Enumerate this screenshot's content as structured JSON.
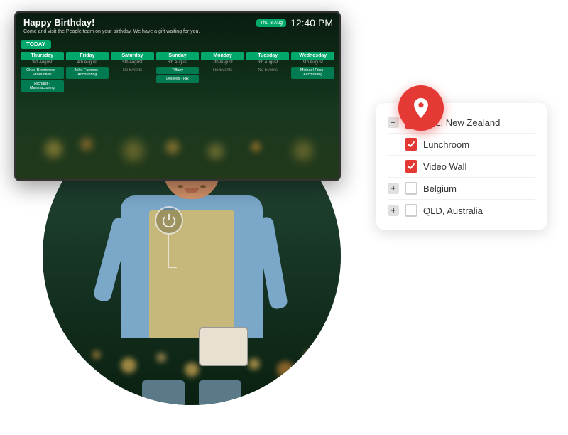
{
  "tv": {
    "birthday_title": "Happy Birthday!",
    "birthday_subtitle": "Come and visit the People team on your birthday. We have a gift waiting for you.",
    "date_badge": "Thu 3 Aug",
    "time": "12:40 PM",
    "today_label": "TODAY",
    "days": [
      {
        "name": "Thursday",
        "date": "3rd August",
        "events": [
          "Chad Brentwood - Production",
          "Richard - Manufacturing"
        ],
        "no_events": false
      },
      {
        "name": "Friday",
        "date": "4th August",
        "events": [
          "John Furness - Accounting"
        ],
        "no_events": false
      },
      {
        "name": "Saturday",
        "date": "5th August",
        "events": [],
        "no_events": true,
        "no_events_text": "No Events"
      },
      {
        "name": "Sunday",
        "date": "6th August",
        "events": [
          "Tiffany",
          "Delores - HR"
        ],
        "no_events": false
      },
      {
        "name": "Monday",
        "date": "7th August",
        "events": [],
        "no_events": true,
        "no_events_text": "No Events"
      },
      {
        "name": "Tuesday",
        "date": "8th August",
        "events": [],
        "no_events": true,
        "no_events_text": "No Events"
      },
      {
        "name": "Wednesday",
        "date": "9th August",
        "events": [
          "Michael Friss - Accounting"
        ],
        "no_events": false
      }
    ]
  },
  "location_card": {
    "items": [
      {
        "id": "akl",
        "type": "parent",
        "expand": "minus",
        "checked": true,
        "label": "AKL, New Zealand"
      },
      {
        "id": "lunchroom",
        "type": "child",
        "expand": null,
        "checked": true,
        "label": "Lunchroom"
      },
      {
        "id": "videowall",
        "type": "child",
        "expand": null,
        "checked": true,
        "label": "Video Wall"
      },
      {
        "id": "belgium",
        "type": "parent",
        "expand": "plus",
        "checked": false,
        "label": "Belgium"
      },
      {
        "id": "qld",
        "type": "parent",
        "expand": "plus",
        "checked": false,
        "label": "QLD, Australia"
      }
    ]
  },
  "power_icon": "⏻"
}
